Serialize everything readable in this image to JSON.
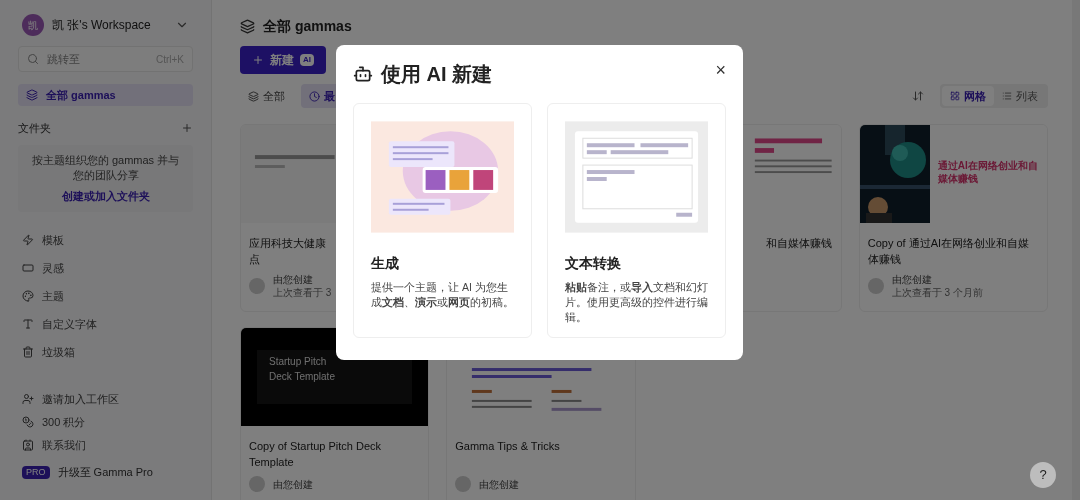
{
  "sidebar": {
    "workspace": {
      "avatar": "凯",
      "name": "凯 张's Workspace"
    },
    "search": {
      "placeholder": "跳转至",
      "shortcut": "Ctrl+K"
    },
    "nav": [
      {
        "label": "全部 gammas",
        "selected": true
      }
    ],
    "folders": {
      "title": "文件夹",
      "empty_text": "按主题组织您的 gammas 并与您的团队分享",
      "link": "创建或加入文件夹"
    },
    "items": [
      "模板",
      "灵感",
      "主题",
      "自定义字体",
      "垃圾箱"
    ],
    "footer_items": [
      "邀请加入工作区",
      "300 积分",
      "联系我们"
    ],
    "upgrade": {
      "badge": "PRO",
      "label": "升级至 Gamma Pro"
    }
  },
  "main": {
    "title": "全部 gammas",
    "new_button": {
      "label": "新建",
      "badge": "AI"
    },
    "filters": [
      {
        "label": "全部",
        "selected": false
      },
      {
        "label": "最",
        "selected": true
      }
    ],
    "views": [
      {
        "label": "网格",
        "selected": true
      },
      {
        "label": "列表",
        "selected": false
      }
    ],
    "cards": [
      {
        "kind": "doc",
        "title_lines": [
          "应用科技大健康",
          "点"
        ],
        "creator": "由您创建",
        "viewed": "上次查看于 3"
      },
      {
        "kind": "covered"
      },
      {
        "kind": "doc-pink",
        "title_lines": [
          "和自媒体赚钱"
        ]
      },
      {
        "thumbnail_text": "通过AI在网络创业和自媒体赚钱",
        "title_lines": [
          "Copy of 通过AI在网络创业和自媒",
          "体赚钱"
        ],
        "creator": "由您创建",
        "viewed": "上次查看于 3 个月前"
      },
      {
        "kind": "dark",
        "thumbnail_lines": [
          "Startup Pitch",
          "Deck Template"
        ],
        "title_lines": [
          "Copy of Startup Pitch Deck",
          "Template"
        ],
        "creator": "由您创建"
      },
      {
        "kind": "tips",
        "title_lines": [
          "Gamma Tips & Tricks"
        ],
        "creator": "由您创建"
      }
    ]
  },
  "modal": {
    "title": "使用 AI 新建",
    "close": "×",
    "options": [
      {
        "kind": "generate",
        "title": "生成",
        "description": "提供一个主题，让 AI 为您生成**文档**、**演示**或**网页**的初稿。"
      },
      {
        "kind": "paste",
        "title": "文本转换",
        "description": "**粘贴**备注，或**导入**文档和幻灯片。使用更高级的控件进行编辑。"
      }
    ]
  },
  "help_button": "?"
}
